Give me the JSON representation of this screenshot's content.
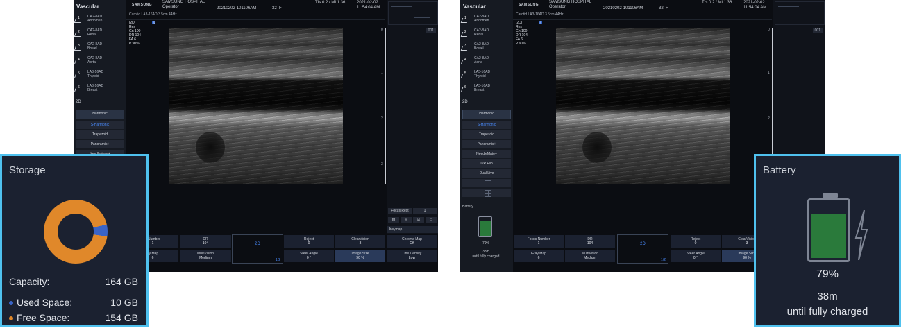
{
  "ui": {
    "sidebar_title": "Vascular",
    "presets": [
      {
        "num": "1",
        "probe": "CA2-8AD",
        "name": "Abdomen"
      },
      {
        "num": "2",
        "probe": "CA2-8AD",
        "name": "Renal"
      },
      {
        "num": "3",
        "probe": "CA2-8AD",
        "name": "Bowel"
      },
      {
        "num": "4",
        "probe": "CA2-8AD",
        "name": "Aorta"
      },
      {
        "num": "5",
        "probe": "LA3-16AD",
        "name": "Thyroid"
      },
      {
        "num": "6",
        "probe": "LA3-16AD",
        "name": "Breast"
      }
    ],
    "mode_section": "2D",
    "mode_buttons": [
      "Harmonic",
      "S-Harmonic",
      "Trapezoid",
      "Panoramic+",
      "NeedleMate+",
      "L/R Flip",
      "Dual Live"
    ],
    "header": {
      "brand": "SAMSUNG",
      "hospital": "SAMSUNG HOSPITAL",
      "operator": "Operator",
      "patient_id": "20210202-101106AM",
      "age": "32",
      "sex": "F",
      "thermal": "TIs 0.2",
      "mi": "/ MI 1.36",
      "date": "2021-02-02",
      "time": "11:54:04 AM",
      "sub": "Carotid  LA3-16AD  3.5cm  44Hz"
    },
    "params": {
      "mode": "[2D]",
      "badge": "S",
      "lines": [
        "Res",
        "Gn    100",
        "DR    104",
        "FA    6",
        "P     90%"
      ]
    },
    "scale_ticks": [
      "0",
      "1",
      "2",
      "3"
    ],
    "mini_label": "001",
    "tools": {
      "focus": "Focus Rest",
      "page": "1",
      "keymap": "Keymap"
    },
    "bottom": {
      "focus_label": "Focus Number",
      "focus_value": "1",
      "dr_label": "DR",
      "dr_value": "104",
      "center_mode": "2D",
      "center_page": "1/2",
      "reject_label": "Reject",
      "reject_value": "0",
      "clearvision_label": "ClearVision",
      "clearvision_value": "3",
      "chroma_label": "Chroma Map",
      "chroma_value": "Off",
      "gray_label": "Gray Map",
      "gray_value": "6",
      "multivision_label": "MultiVision",
      "multivision_value": "Medium",
      "steer_label": "Steer Angle",
      "steer_value": "0 °",
      "imagesize_label": "Image Size",
      "imagesize_value": "90 %",
      "linedensity_label": "Line Density",
      "linedensity_value": "Low"
    },
    "left_cut": {
      "focus_label": "s Number",
      "gray_label": "ay Map",
      "gray_value": "6"
    },
    "mini_battery": {
      "title": "Battery",
      "percent": "79%",
      "time": "38m",
      "note": "until fully charged"
    }
  },
  "storage": {
    "title": "Storage",
    "capacity_label": "Capacity:",
    "capacity_value": "164 GB",
    "used_label": "Used Space:",
    "used_value": "10 GB",
    "free_label": "Free Space:",
    "free_value": "154 GB",
    "used_fraction": 0.061,
    "colors": {
      "used": "#3a64c6",
      "free": "#e0882a"
    }
  },
  "battery": {
    "title": "Battery",
    "percent": "79%",
    "level": 0.79,
    "time": "38m",
    "note": "until fully charged",
    "colors": {
      "fill": "#2a7a3b",
      "frame": "#7e8594"
    }
  }
}
